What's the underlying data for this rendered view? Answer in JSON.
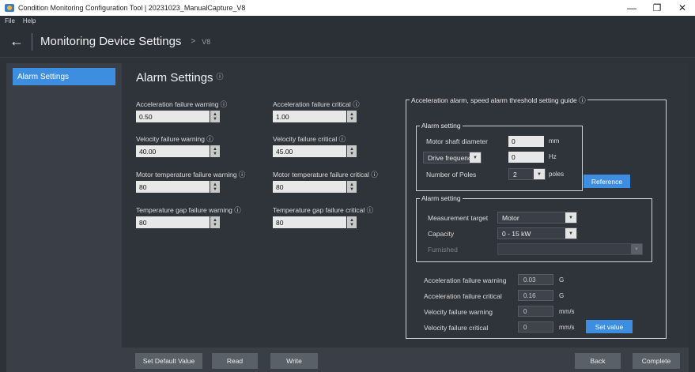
{
  "window": {
    "title": "Condition Monitoring Configuration Tool | 20231023_ManualCapture_V8",
    "minimize_glyph": "—",
    "maximize_glyph": "❐",
    "close_glyph": "✕"
  },
  "menu": {
    "file": "File",
    "help": "Help"
  },
  "header": {
    "back_glyph": "←",
    "title": "Monitoring Device Settings",
    "separator": ">",
    "breadcrumb": "V8"
  },
  "sidebar": {
    "items": [
      {
        "label": "Alarm Settings"
      }
    ]
  },
  "main": {
    "title": "Alarm Settings",
    "info_glyph": "ⓘ",
    "fields": [
      {
        "label": "Acceleration failure warning ⓘ",
        "value": "0.50"
      },
      {
        "label": "Acceleration failure critical ⓘ",
        "value": "1.00"
      },
      {
        "label": "Velocity failure warning ⓘ",
        "value": "40.00"
      },
      {
        "label": "Velocity failure critical ⓘ",
        "value": "45.00"
      },
      {
        "label": "Motor temperature failure warning ⓘ",
        "value": "80"
      },
      {
        "label": "Motor temperature failure critical ⓘ",
        "value": "80"
      },
      {
        "label": "Temperature gap failure warning ⓘ",
        "value": "80"
      },
      {
        "label": "Temperature gap failure critical ⓘ",
        "value": "80"
      }
    ]
  },
  "guide": {
    "title": "Acceleration alarm, speed alarm threshold setting guide ⓘ",
    "alarm_setting_1": {
      "title": "Alarm setting",
      "motor_shaft_diameter_label": "Motor shaft diameter",
      "motor_shaft_diameter_value": "0",
      "motor_shaft_diameter_unit": "mm",
      "drive_frequency_label": "Drive frequency",
      "drive_frequency_value": "0",
      "drive_frequency_unit": "Hz",
      "poles_label": "Number of Poles",
      "poles_value": "2",
      "poles_unit": "poles",
      "reference_button": "Reference"
    },
    "alarm_setting_2": {
      "title": "Alarm setting",
      "measurement_target_label": "Measurement target",
      "measurement_target_value": "Motor",
      "capacity_label": "Capacity",
      "capacity_value": "0 - 15 kW",
      "furnished_label": "Furnished",
      "furnished_value": ""
    },
    "results": [
      {
        "label": "Acceleration failure warning",
        "value": "0.03",
        "unit": "G"
      },
      {
        "label": "Acceleration failure critical",
        "value": "0.16",
        "unit": "G"
      },
      {
        "label": "Velocity failure warning",
        "value": "0",
        "unit": "mm/s"
      },
      {
        "label": "Velocity failure critical",
        "value": "0",
        "unit": "mm/s"
      }
    ],
    "set_value_button": "Set value"
  },
  "footer": {
    "set_default": "Set Default Value",
    "read": "Read",
    "write": "Write",
    "back": "Back",
    "complete": "Complete"
  },
  "colors": {
    "accent": "#3d8ee0",
    "background": "#2d3138",
    "panel": "#2f343b",
    "sidebar": "#3a3f47"
  }
}
